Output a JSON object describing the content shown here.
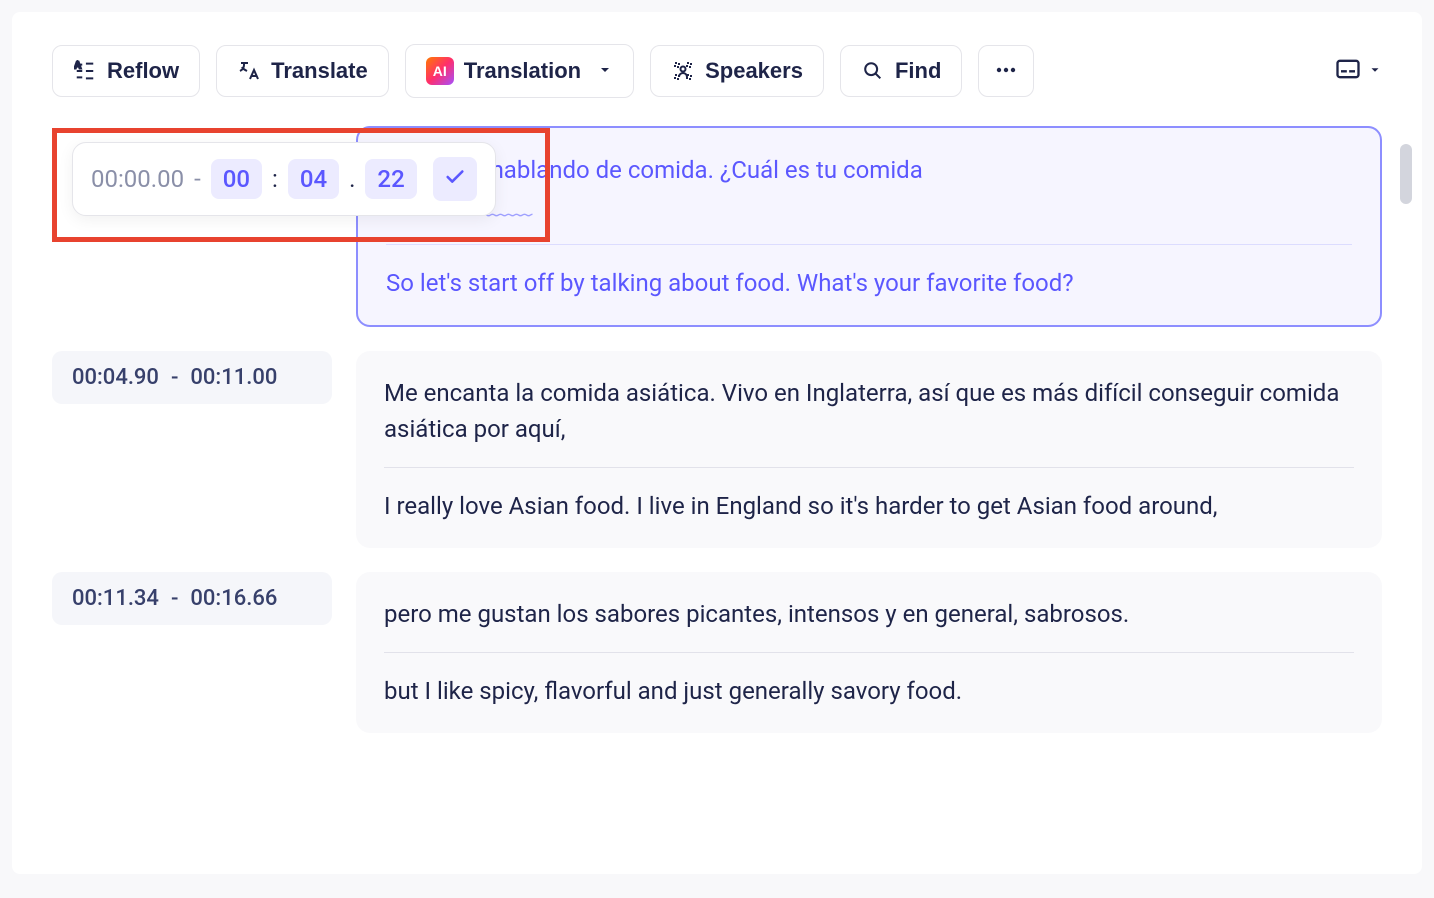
{
  "toolbar": {
    "reflow": "Reflow",
    "translate": "Translate",
    "translation": "Translation",
    "speakers": "Speakers",
    "find": "Find"
  },
  "timeEditor": {
    "start": "00:00.00",
    "endMin": "00",
    "endSec": "04",
    "endFrac": "22"
  },
  "segments": [
    {
      "start": "00:00.00",
      "end": "00:04.22",
      "active": true,
      "source_visible": "pecemos hablando de comida. ¿Cuál es tu comida",
      "source_line2_obscured": true,
      "translation": "So let's start off by talking about food. What's your favorite food?"
    },
    {
      "start": "00:04.90",
      "end": "00:11.00",
      "active": false,
      "source": "Me encanta la comida asiática. Vivo en Inglaterra, así que es más difícil conseguir comida asiática por aquí,",
      "translation": "I really love Asian food. I live in England so it's harder to get Asian food around,"
    },
    {
      "start": "00:11.34",
      "end": "00:16.66",
      "active": false,
      "source": "pero me gustan los sabores picantes, intensos y en general, sabrosos.",
      "translation": "but I like spicy, flavorful and just generally savory food."
    }
  ]
}
